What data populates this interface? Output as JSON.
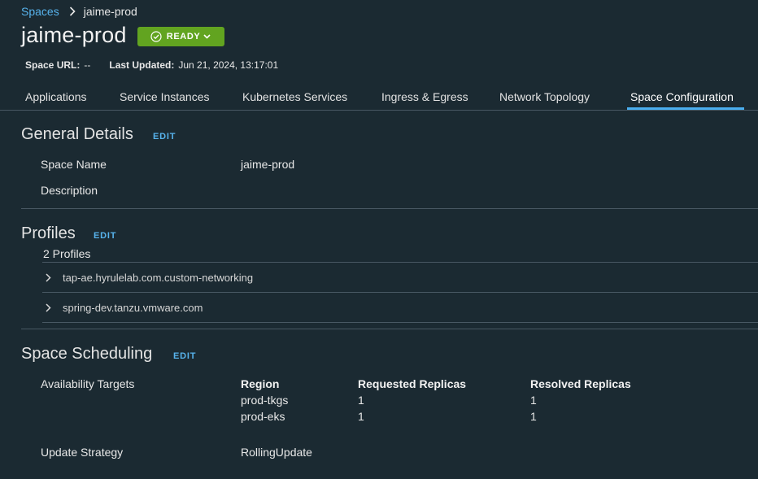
{
  "breadcrumb": {
    "parent": "Spaces",
    "current": "jaime-prod"
  },
  "header": {
    "title": "jaime-prod",
    "status": "READY",
    "status_color": "#62a420"
  },
  "meta": {
    "space_url_label": "Space URL:",
    "space_url_value": "--",
    "last_updated_label": "Last Updated:",
    "last_updated_value": "Jun 21, 2024, 13:17:01"
  },
  "tabs": [
    {
      "label": "Applications"
    },
    {
      "label": "Service Instances"
    },
    {
      "label": "Kubernetes Services"
    },
    {
      "label": "Ingress & Egress"
    },
    {
      "label": "Network Topology"
    },
    {
      "label": "Space Configuration",
      "active": true
    }
  ],
  "general": {
    "title": "General Details",
    "edit": "EDIT",
    "name_label": "Space Name",
    "name_value": "jaime-prod",
    "description_label": "Description"
  },
  "profiles": {
    "title": "Profiles",
    "edit": "EDIT",
    "count": "2 Profiles",
    "items": [
      {
        "name": "tap-ae.hyrulelab.com.custom-networking"
      },
      {
        "name": "spring-dev.tanzu.vmware.com"
      }
    ]
  },
  "scheduling": {
    "title": "Space Scheduling",
    "edit": "EDIT",
    "availability_label": "Availability Targets",
    "columns": [
      "Region",
      "Requested Replicas",
      "Resolved Replicas"
    ],
    "rows": [
      [
        "prod-tkgs",
        "1",
        "1"
      ],
      [
        "prod-eks",
        "1",
        "1"
      ]
    ],
    "update_strategy_label": "Update Strategy",
    "update_strategy_value": "RollingUpdate"
  },
  "colors": {
    "background": "#1b2a32",
    "accent": "#57b3ec",
    "tab_underline": "#4aaeef"
  }
}
